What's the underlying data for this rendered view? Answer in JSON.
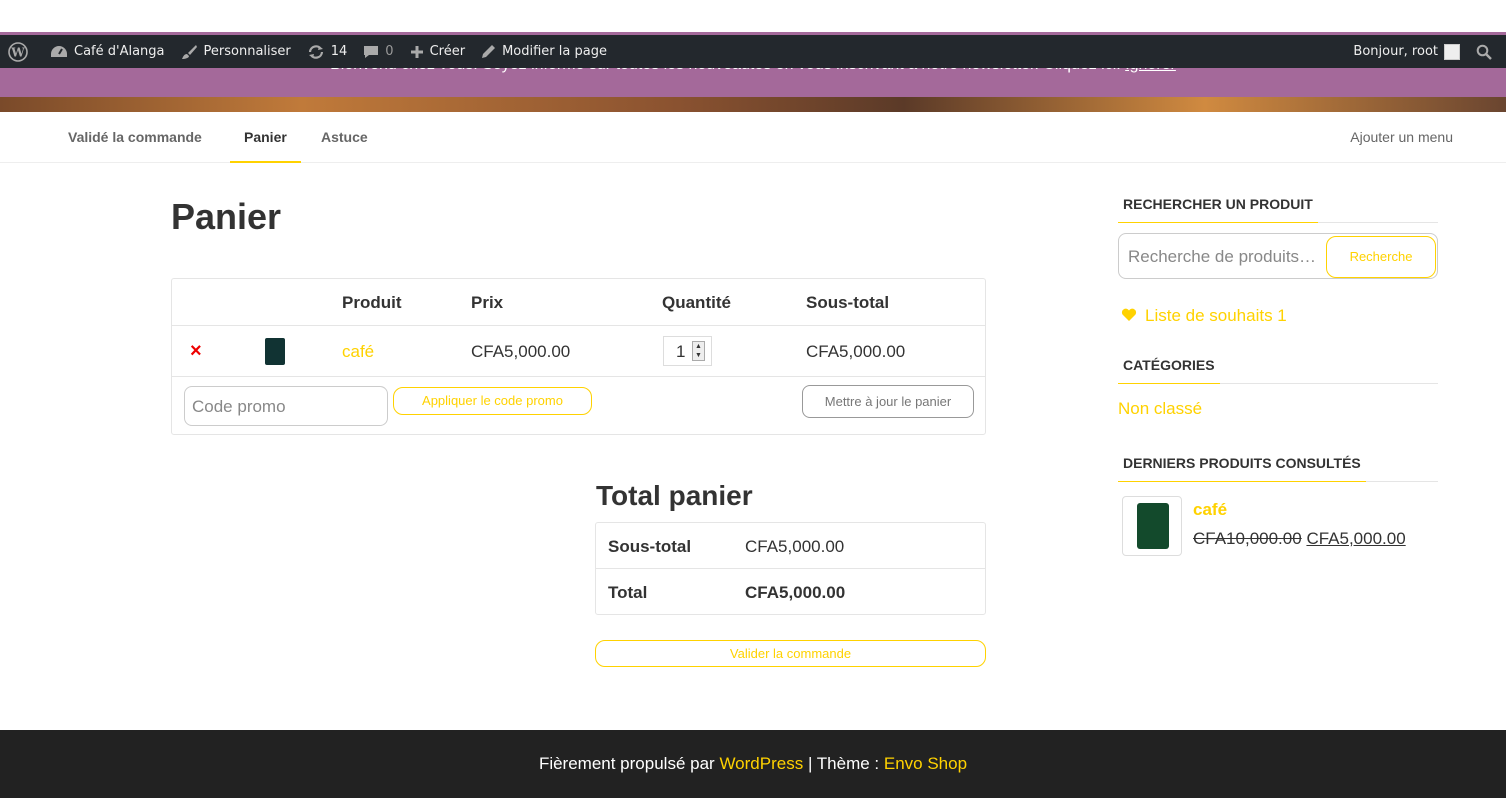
{
  "banner": {
    "text": "Bienvenu chez vous. Soyez informé sur toutes les nouveautés en vous inscrivant à notre newsletter. Cliquez ici.",
    "dismiss_link": "Ignorer"
  },
  "adminbar": {
    "site_name": "Café d'Alanga",
    "customize": "Personnaliser",
    "updates_count": "14",
    "comments_count": "0",
    "new": "Créer",
    "edit_page": "Modifier la page",
    "greeting": "Bonjour, root"
  },
  "nav": {
    "items": [
      {
        "label": "Validé la commande"
      },
      {
        "label": "Panier"
      },
      {
        "label": "Astuce"
      }
    ],
    "add_menu": "Ajouter un menu"
  },
  "page_title": "Panier",
  "cart": {
    "headers": {
      "product": "Produit",
      "price": "Prix",
      "quantity": "Quantité",
      "subtotal": "Sous-total"
    },
    "rows": [
      {
        "remove": "×",
        "product": "café",
        "price": "CFA5,000.00",
        "quantity": "1",
        "subtotal": "CFA5,000.00"
      }
    ],
    "coupon_placeholder": "Code promo",
    "apply_coupon": "Appliquer le code promo",
    "update_cart": "Mettre à jour le panier"
  },
  "totals": {
    "title": "Total panier",
    "subtotal_label": "Sous-total",
    "subtotal_value": "CFA5,000.00",
    "total_label": "Total",
    "total_value": "CFA5,000.00",
    "checkout": "Valider la commande"
  },
  "sidebar": {
    "search_title": "RECHERCHER UN PRODUIT",
    "search_placeholder": "Recherche de produits…",
    "search_button": "Recherche",
    "wishlist": "Liste de souhaits 1",
    "categories_title": "CATÉGORIES",
    "category": "Non classé",
    "recent_title": "DERNIERS PRODUITS CONSULTÉS",
    "recent_name": "café",
    "recent_old_price": "CFA10,000.00",
    "recent_price": "CFA5,000.00"
  },
  "footer": {
    "prefix": "Fièrement propulsé par",
    "wp": "WordPress",
    "sep": "| Thème :",
    "theme": "Envo Shop"
  },
  "colors": {
    "accent": "#ffd200",
    "banner": "#a4699a",
    "adminbar": "#23282d",
    "footer": "#222222",
    "remove": "#ee0000"
  }
}
